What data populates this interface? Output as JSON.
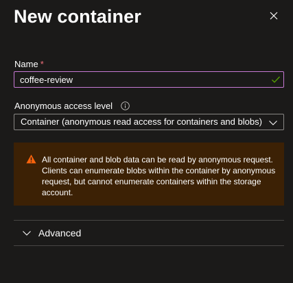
{
  "panel": {
    "title": "New container",
    "close_icon": "close-icon"
  },
  "name_field": {
    "label": "Name",
    "required_marker": "*",
    "value": "coffee-review",
    "valid_icon": "checkmark-icon",
    "border_color": "#c87ad6"
  },
  "access_level": {
    "label": "Anonymous access level",
    "info_icon": "info-icon",
    "selected_value": "Container (anonymous read access for containers and blobs)",
    "dropdown_icon": "chevron-down-icon"
  },
  "warning": {
    "icon": "warning-icon",
    "text": "All container and blob data can be read by anonymous request. Clients can enumerate blobs within the container by anonymous request, but cannot enumerate containers within the storage account.",
    "background_color": "#3c2105",
    "icon_color": "#f7630c"
  },
  "advanced": {
    "label": "Advanced",
    "expand_icon": "chevron-down-icon",
    "expanded": false
  }
}
